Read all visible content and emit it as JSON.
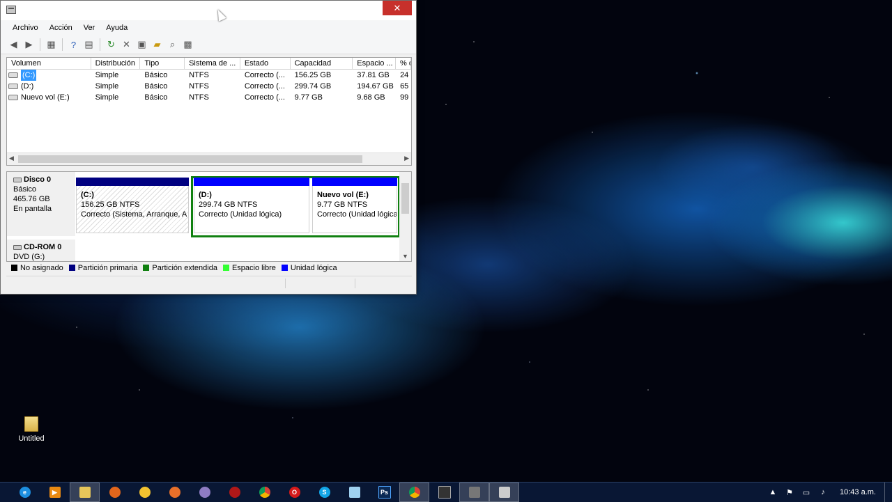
{
  "window": {
    "close_glyph": "✕",
    "menu": [
      "Archivo",
      "Acción",
      "Ver",
      "Ayuda"
    ],
    "toolbar_icons": [
      "back-arrow-icon",
      "forward-arrow-icon",
      "console-tree-icon",
      "help-icon",
      "properties-icon",
      "refresh-icon",
      "delete-icon",
      "properties-sheet-icon",
      "open-folder-icon",
      "search-icon",
      "export-icon"
    ]
  },
  "volume_list": {
    "columns": [
      "Volumen",
      "Distribución",
      "Tipo",
      "Sistema de ...",
      "Estado",
      "Capacidad",
      "Espacio ...",
      "% d"
    ],
    "rows": [
      {
        "volume": "(C:)",
        "layout": "Simple",
        "type": "Básico",
        "fs": "NTFS",
        "status": "Correcto (...",
        "capacity": "156.25 GB",
        "free": "37.81 GB",
        "pct": "24",
        "selected": true
      },
      {
        "volume": "(D:)",
        "layout": "Simple",
        "type": "Básico",
        "fs": "NTFS",
        "status": "Correcto (...",
        "capacity": "299.74 GB",
        "free": "194.67 GB",
        "pct": "65",
        "selected": false
      },
      {
        "volume": "Nuevo vol (E:)",
        "layout": "Simple",
        "type": "Básico",
        "fs": "NTFS",
        "status": "Correcto (...",
        "capacity": "9.77 GB",
        "free": "9.68 GB",
        "pct": "99",
        "selected": false
      }
    ]
  },
  "disks": [
    {
      "name": "Disco 0",
      "kind": "Básico",
      "size": "465.76 GB",
      "state": "En pantalla",
      "partitions": [
        {
          "name": "(C:)",
          "size": "156.25 GB NTFS",
          "status": "Correcto (Sistema, Arranque, A",
          "bar_color": "#000080"
        },
        {
          "name": "(D:)",
          "size": "299.74 GB NTFS",
          "status": "Correcto (Unidad lógica)",
          "bar_color": "#0000ff"
        },
        {
          "name": "Nuevo vol  (E:)",
          "size": "9.77 GB NTFS",
          "status": "Correcto (Unidad lógica",
          "bar_color": "#0000ff"
        }
      ]
    },
    {
      "name": "CD-ROM 0",
      "kind": "DVD (G:)"
    }
  ],
  "legend": [
    {
      "label": "No asignado",
      "color": "#000000"
    },
    {
      "label": "Partición primaria",
      "color": "#000080"
    },
    {
      "label": "Partición extendida",
      "color": "#108010"
    },
    {
      "label": "Espacio libre",
      "color": "#33ff33"
    },
    {
      "label": "Unidad lógica",
      "color": "#0000ff"
    }
  ],
  "desktop": {
    "icon_label": "Untitled"
  },
  "taskbar": {
    "apps": [
      "internet-explorer-icon",
      "media-player-icon",
      "file-explorer-icon",
      "firefox-icon",
      "app-yellow-icon",
      "app-orange-icon",
      "app-purple-icon",
      "app-red-icon",
      "chrome-icon",
      "opera-icon",
      "skype-icon",
      "notepad-icon",
      "photoshop-icon",
      "chrome-icon",
      "console-icon",
      "tool-icon",
      "disk-management-icon"
    ],
    "photoshop_label": "Ps",
    "clock": "10:43 a.m."
  }
}
